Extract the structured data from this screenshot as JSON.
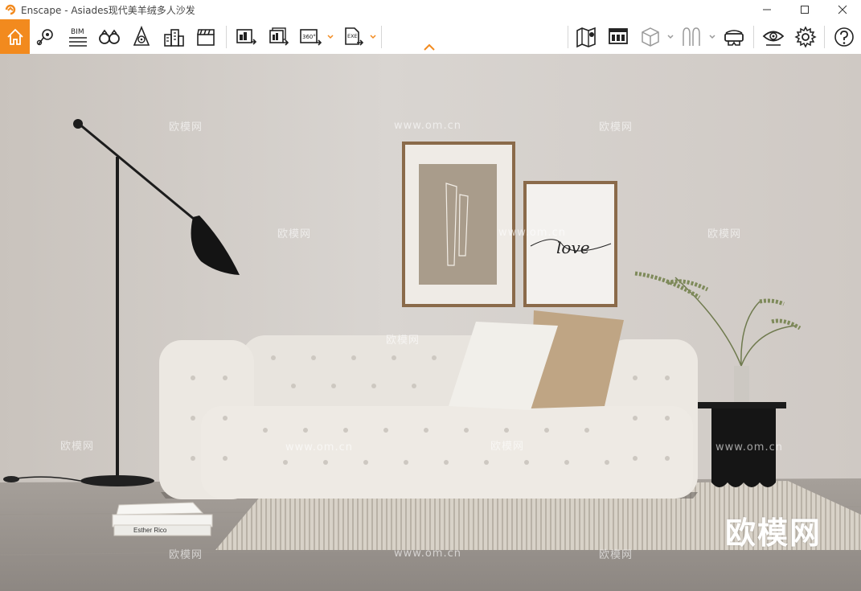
{
  "window": {
    "title": "Enscape - Asiades现代美羊绒多人沙发"
  },
  "toolbar": {
    "bim_label": "BIM",
    "pano_label": "360°",
    "exe_label": "EXE",
    "items": [
      {
        "name": "home-icon"
      },
      {
        "name": "location-pin-icon"
      },
      {
        "name": "bim-icon"
      },
      {
        "name": "binoculars-icon"
      },
      {
        "name": "perspective-icon"
      },
      {
        "name": "buildings-icon"
      },
      {
        "name": "clapperboard-icon"
      },
      {
        "name": "render-image-icon"
      },
      {
        "name": "batch-render-icon"
      },
      {
        "name": "panorama-360-icon"
      },
      {
        "name": "export-exe-icon"
      },
      {
        "name": "map-icon"
      },
      {
        "name": "asset-library-icon"
      },
      {
        "name": "cube-icon"
      },
      {
        "name": "material-icon"
      },
      {
        "name": "vr-headset-icon"
      },
      {
        "name": "visual-settings-eye-icon"
      },
      {
        "name": "settings-gear-icon"
      },
      {
        "name": "help-icon"
      }
    ],
    "accent_color": "#f28a1e"
  },
  "scene": {
    "book_title": "Esther Rico",
    "poster_text": "love",
    "watermark_big": "欧模网",
    "watermark_small_cn": "欧模网",
    "watermark_url": "www.om.cn"
  }
}
